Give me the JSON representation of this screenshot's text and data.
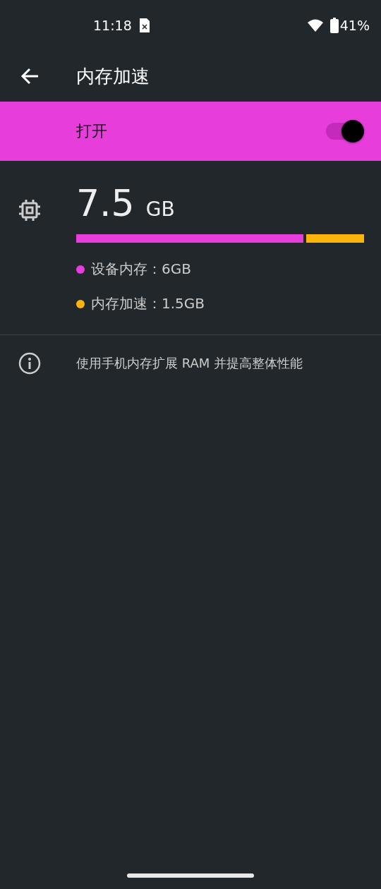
{
  "status_bar": {
    "time": "11:18",
    "battery": "41%"
  },
  "header": {
    "title": "内存加速"
  },
  "master_switch": {
    "label": "打开",
    "on": true
  },
  "memory": {
    "total": "7.5",
    "unit": "GB",
    "level": 0.8,
    "legend": [
      {
        "label": "设备内存：6GB",
        "color": "#e63ddb"
      },
      {
        "label": "内存加速：1.5GB",
        "color": "#fbb40c"
      }
    ]
  },
  "info": {
    "text": "使用手机内存扩展 RAM 并提高整体性能"
  }
}
